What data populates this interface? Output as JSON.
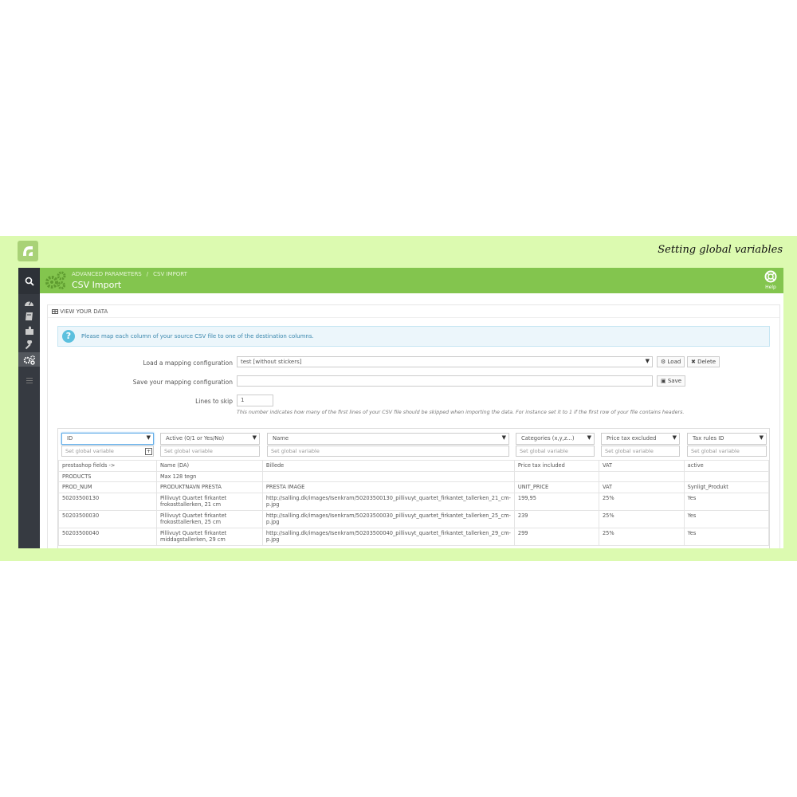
{
  "banner": {
    "caption": "Setting global variables"
  },
  "sidebar": {
    "items": [
      "search-icon",
      "dashboard-icon",
      "catalog-icon",
      "modules-icon",
      "tools-icon",
      "advanced-parameters-icon",
      "menu-icon"
    ]
  },
  "header": {
    "breadcrumb": [
      "ADVANCED PARAMETERS",
      "CSV IMPORT"
    ],
    "breadcrumb_sep": "/",
    "title": "CSV Import",
    "help_label": "Help",
    "accent": "#83c54e"
  },
  "panel": {
    "heading": "VIEW YOUR DATA",
    "alert": "Please map each column of your source CSV file to one of the destination columns.",
    "load_label": "Load a mapping configuration",
    "load_value": "test [without stickers]",
    "load_button": "Load",
    "delete_button": "Delete",
    "save_label": "Save your mapping configuration",
    "save_value": "",
    "save_button": "Save",
    "skip_label": "Lines to skip",
    "skip_value": "1",
    "skip_help": "This number indicates how many of the first lines of your CSV file should be skipped when importing the data. For instance set it to 1 if the first row of your file contains headers."
  },
  "mapping": {
    "columns": [
      "ID",
      "Active (0/1 or Yes/No)",
      "Name",
      "Categories (x,y,z...)",
      "Price tax excluded",
      "Tax rules ID"
    ],
    "global_placeholder": "Set global variable"
  },
  "table": {
    "rows": [
      [
        "prestashop fields ->",
        "Name (DA)",
        "Billede",
        "Price tax included",
        "VAT",
        "active"
      ],
      [
        "PRODUCTS",
        "Max 128 tegn",
        "",
        "",
        "",
        ""
      ],
      [
        "PROD_NUM",
        "PRODUKTNAVN PRESTA",
        "PRESTA IMAGE",
        "UNIT_PRICE",
        "VAT",
        "Synligt_Produkt"
      ],
      [
        "50203500130",
        "Pillivuyt Quartet firkantet frokosttallerken, 21 cm",
        "http://salling.dk/images/Isenkram/50203500130_pillivuyt_quartet_firkantet_tallerken_21_cm-p.jpg",
        "199,95",
        "25%",
        "Yes"
      ],
      [
        "50203500030",
        "Pillivuyt Quartet firkantet frokosttallerken, 25 cm",
        "http://salling.dk/images/Isenkram/50203500030_pillivuyt_quartet_firkantet_tallerken_25_cm-p.jpg",
        "239",
        "25%",
        "Yes"
      ],
      [
        "50203500040",
        "Pillivuyt Quartet firkantet middagstallerken, 29 cm",
        "http://salling.dk/images/Isenkram/50203500040_pillivuyt_quartet_firkantet_tallerken_29_cm-p.jpg",
        "299",
        "25%",
        "Yes"
      ]
    ]
  }
}
